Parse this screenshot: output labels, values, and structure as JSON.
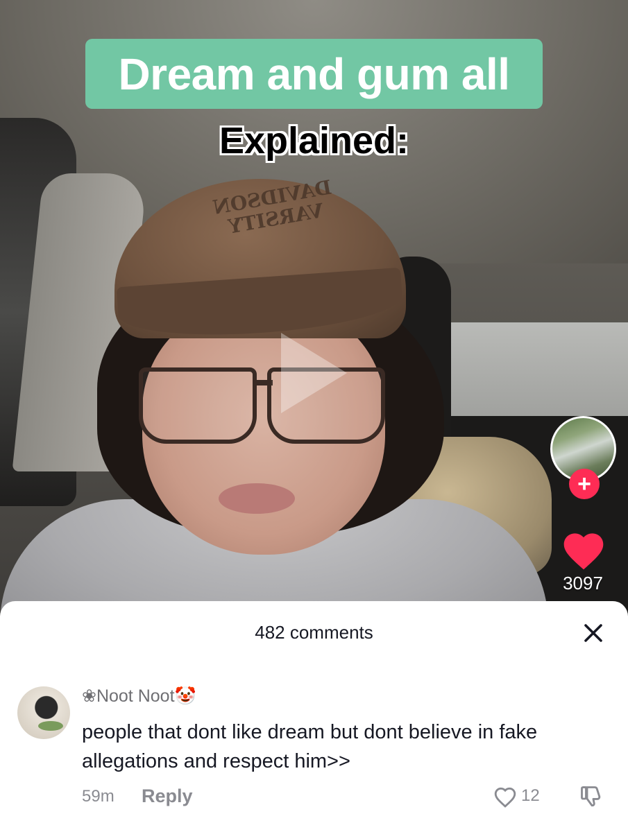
{
  "video": {
    "caption_title": "Dream and gum all",
    "caption_subtitle": "Explained:",
    "cap_print": "DAVIDSON\nVARSITY",
    "like_count": "3097",
    "follow_symbol": "+",
    "colors": {
      "caption_box": "#72c7a4",
      "like": "#fe2c55",
      "follow": "#fe2c55"
    }
  },
  "comments_sheet": {
    "title": "482 comments",
    "close_icon": "close-icon",
    "comments": [
      {
        "username": "❀Noot Noot🤡",
        "text": "people that dont like dream but dont believe in fake allegations and respect him>>",
        "time": "59m",
        "reply_label": "Reply",
        "like_count": "12"
      }
    ]
  }
}
